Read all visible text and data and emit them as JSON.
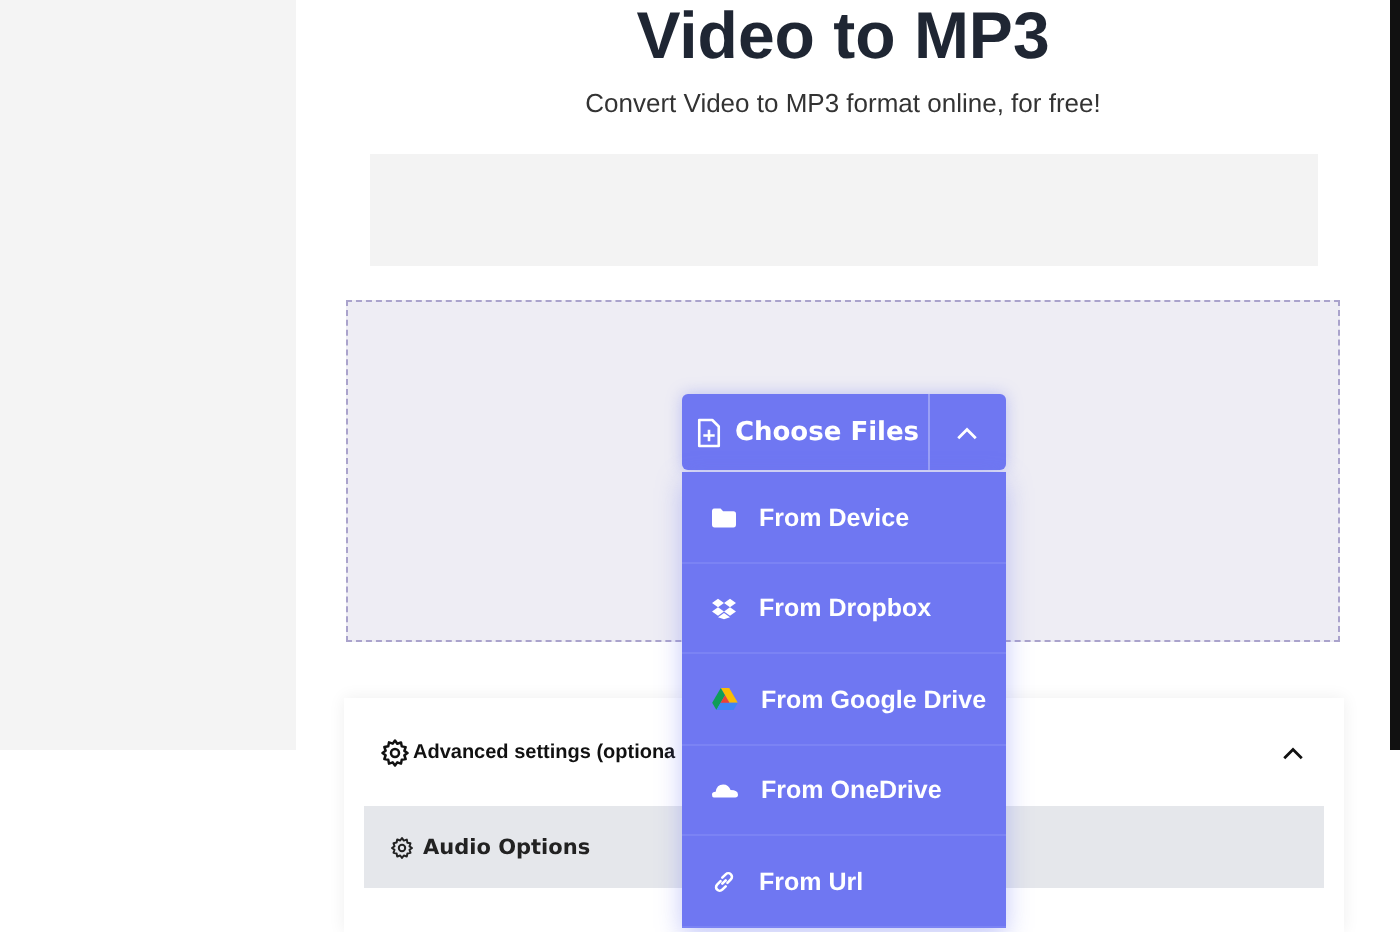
{
  "title": "Video to MP3",
  "subtitle": "Convert Video to MP3 format online, for free!",
  "uploader": {
    "button": "Choose Files",
    "expanded": true,
    "menu": [
      {
        "kind": "folder",
        "label": "From Device"
      },
      {
        "kind": "boxes",
        "label": "From Dropbox"
      },
      {
        "kind": "drive",
        "label": "From Google Drive"
      },
      {
        "kind": "cloud",
        "label": "From OneDrive"
      },
      {
        "kind": "link",
        "label": "From Url"
      }
    ]
  },
  "advanced": {
    "title": "Advanced settings (optiona",
    "expanded": true,
    "sections": [
      {
        "label": "Audio Options"
      }
    ]
  }
}
